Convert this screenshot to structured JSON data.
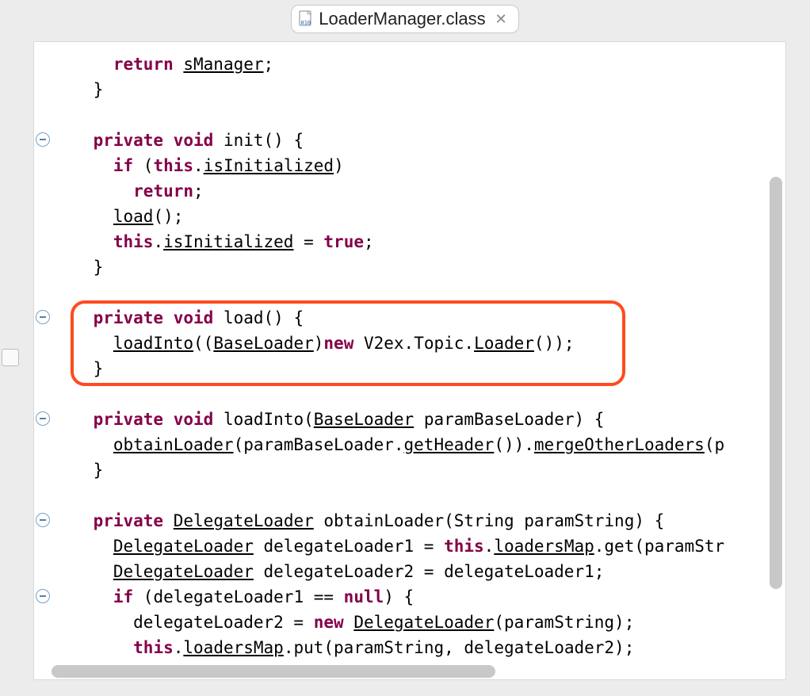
{
  "tab": {
    "filename": "LoaderManager.class",
    "icon": "class-file-icon",
    "close": "✕"
  },
  "code": {
    "lines": [
      {
        "indent": 3,
        "tokens": [
          {
            "t": "return",
            "c": "kw"
          },
          {
            "t": " "
          },
          {
            "t": "sManager",
            "c": "u"
          },
          {
            "t": ";"
          }
        ]
      },
      {
        "indent": 2,
        "tokens": [
          {
            "t": "}"
          }
        ]
      },
      {
        "indent": 0,
        "tokens": []
      },
      {
        "fold": true,
        "indent": 2,
        "tokens": [
          {
            "t": "private",
            "c": "kw"
          },
          {
            "t": " "
          },
          {
            "t": "void",
            "c": "kw"
          },
          {
            "t": " init() {"
          }
        ]
      },
      {
        "indent": 3,
        "tokens": [
          {
            "t": "if",
            "c": "kw"
          },
          {
            "t": " ("
          },
          {
            "t": "this",
            "c": "kw"
          },
          {
            "t": "."
          },
          {
            "t": "isInitialized",
            "c": "u"
          },
          {
            "t": ")"
          }
        ]
      },
      {
        "indent": 4,
        "tokens": [
          {
            "t": "return",
            "c": "kw"
          },
          {
            "t": ";"
          }
        ]
      },
      {
        "indent": 3,
        "tokens": [
          {
            "t": "load",
            "c": "u"
          },
          {
            "t": "();"
          }
        ]
      },
      {
        "indent": 3,
        "tokens": [
          {
            "t": "this",
            "c": "kw"
          },
          {
            "t": "."
          },
          {
            "t": "isInitialized",
            "c": "u"
          },
          {
            "t": " = "
          },
          {
            "t": "true",
            "c": "kw"
          },
          {
            "t": ";"
          }
        ]
      },
      {
        "indent": 2,
        "tokens": [
          {
            "t": "}"
          }
        ]
      },
      {
        "indent": 0,
        "tokens": []
      },
      {
        "fold": true,
        "highlightStart": true,
        "indent": 2,
        "tokens": [
          {
            "t": "private",
            "c": "kw"
          },
          {
            "t": " "
          },
          {
            "t": "void",
            "c": "kw"
          },
          {
            "t": " load() {"
          }
        ]
      },
      {
        "indent": 3,
        "tokens": [
          {
            "t": "loadInto",
            "c": "u"
          },
          {
            "t": "(("
          },
          {
            "t": "BaseLoader",
            "c": "u"
          },
          {
            "t": ")"
          },
          {
            "t": "new",
            "c": "kw"
          },
          {
            "t": " V2ex.Topic."
          },
          {
            "t": "Loader",
            "c": "u"
          },
          {
            "t": "());"
          }
        ]
      },
      {
        "highlightEnd": true,
        "indent": 2,
        "tokens": [
          {
            "t": "}"
          }
        ]
      },
      {
        "indent": 0,
        "tokens": []
      },
      {
        "fold": true,
        "indent": 2,
        "tokens": [
          {
            "t": "private",
            "c": "kw"
          },
          {
            "t": " "
          },
          {
            "t": "void",
            "c": "kw"
          },
          {
            "t": " loadInto("
          },
          {
            "t": "BaseLoader",
            "c": "u"
          },
          {
            "t": " paramBaseLoader) {"
          }
        ]
      },
      {
        "indent": 3,
        "tokens": [
          {
            "t": "obtainLoader",
            "c": "u"
          },
          {
            "t": "(paramBaseLoader."
          },
          {
            "t": "getHeader",
            "c": "u"
          },
          {
            "t": "())."
          },
          {
            "t": "mergeOtherLoaders",
            "c": "u"
          },
          {
            "t": "(p"
          }
        ]
      },
      {
        "indent": 2,
        "tokens": [
          {
            "t": "}"
          }
        ]
      },
      {
        "indent": 0,
        "tokens": []
      },
      {
        "fold": true,
        "indent": 2,
        "tokens": [
          {
            "t": "private",
            "c": "kw"
          },
          {
            "t": " "
          },
          {
            "t": "DelegateLoader",
            "c": "u"
          },
          {
            "t": " obtainLoader(String paramString) {"
          }
        ]
      },
      {
        "indent": 3,
        "tokens": [
          {
            "t": "DelegateLoader",
            "c": "u"
          },
          {
            "t": " delegateLoader1 = "
          },
          {
            "t": "this",
            "c": "kw"
          },
          {
            "t": "."
          },
          {
            "t": "loadersMap",
            "c": "u"
          },
          {
            "t": ".get(paramStr"
          }
        ]
      },
      {
        "indent": 3,
        "tokens": [
          {
            "t": "DelegateLoader",
            "c": "u"
          },
          {
            "t": " delegateLoader2 = delegateLoader1;"
          }
        ]
      },
      {
        "fold": true,
        "indent": 3,
        "tokens": [
          {
            "t": "if",
            "c": "kw"
          },
          {
            "t": " (delegateLoader1 == "
          },
          {
            "t": "null",
            "c": "kw"
          },
          {
            "t": ") {"
          }
        ]
      },
      {
        "indent": 4,
        "tokens": [
          {
            "t": "delegateLoader2 = "
          },
          {
            "t": "new",
            "c": "kw"
          },
          {
            "t": " "
          },
          {
            "t": "DelegateLoader",
            "c": "u"
          },
          {
            "t": "(paramString);"
          }
        ]
      },
      {
        "indent": 4,
        "tokens": [
          {
            "t": "this",
            "c": "kw"
          },
          {
            "t": "."
          },
          {
            "t": "loadersMap",
            "c": "u"
          },
          {
            "t": ".put(paramString, delegateLoader2);"
          }
        ]
      },
      {
        "indent": 3,
        "tokens": [
          {
            "t": "}"
          }
        ]
      }
    ]
  },
  "scroll": {
    "vThumbTop": 140,
    "vThumbHeight": 520,
    "hThumbLeft": 10,
    "hThumbWidth": 560
  },
  "leftMarkerTop": 440
}
